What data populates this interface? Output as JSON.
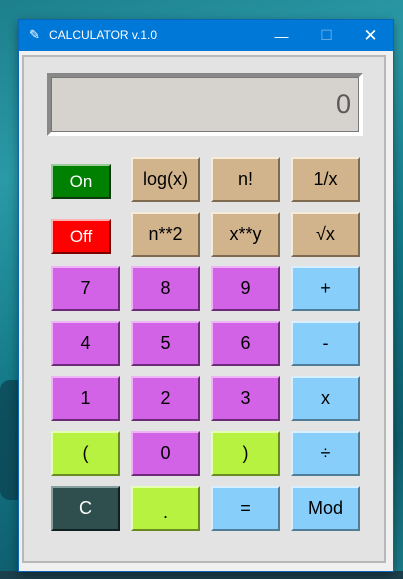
{
  "window": {
    "title": "CALCULATOR v.1.0",
    "minimize_icon": "minimize-icon",
    "maximize_icon": "maximize-icon",
    "close_icon": "close-icon",
    "minimize_glyph": "—",
    "maximize_glyph": "☐",
    "close_glyph": "✕",
    "app_icon_glyph": "✎"
  },
  "display": {
    "value": "0"
  },
  "power": {
    "on_label": "On",
    "off_label": "Off"
  },
  "functions": {
    "log": "log(x)",
    "factorial": "n!",
    "reciprocal": "1/x",
    "square": "n**2",
    "power": "x**y",
    "sqrt": "√x"
  },
  "digits": {
    "d7": "7",
    "d8": "8",
    "d9": "9",
    "d4": "4",
    "d5": "5",
    "d6": "6",
    "d1": "1",
    "d2": "2",
    "d3": "3",
    "d0": "0"
  },
  "operators": {
    "plus": "+",
    "minus": "-",
    "multiply": "x",
    "divide": "÷",
    "equals": "=",
    "mod": "Mod"
  },
  "misc": {
    "open_paren": "(",
    "close_paren": ")",
    "clear": "C",
    "decimal": "."
  },
  "colors": {
    "titlebar": "#0078d7",
    "function_key": "#d2b48c",
    "digit_key": "#d262e6",
    "operator_key": "#87cefa",
    "paren_key": "#b6f23f",
    "on_key": "#008000",
    "off_key": "#ff0000",
    "clear_key": "#2f4f4f"
  }
}
